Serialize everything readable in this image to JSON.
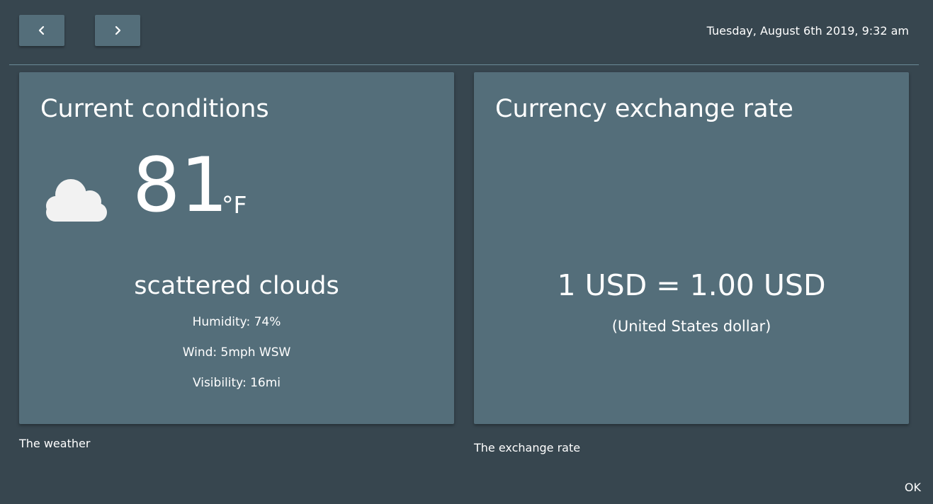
{
  "header": {
    "prev_icon": "chevron-left-icon",
    "next_icon": "chevron-right-icon",
    "datetime": "Tuesday, August 6th 2019, 9:32 am"
  },
  "weather": {
    "title": "Current conditions",
    "icon": "cloud-icon",
    "temperature": "81",
    "unit": "°F",
    "condition": "scattered clouds",
    "humidity": "Humidity: 74%",
    "wind": "Wind: 5mph WSW",
    "visibility": "Visibility: 16mi",
    "caption": "The weather"
  },
  "exchange": {
    "title": "Currency exchange rate",
    "rate": "1 USD = 1.00 USD",
    "currency_name": "(United States dollar)",
    "caption": "The exchange rate"
  },
  "footer": {
    "ok_label": "OK"
  },
  "colors": {
    "background": "#37464f",
    "card": "#546e7a",
    "divider": "#6b8a97",
    "text": "#ffffff",
    "cloud": "#f2f2f2"
  }
}
